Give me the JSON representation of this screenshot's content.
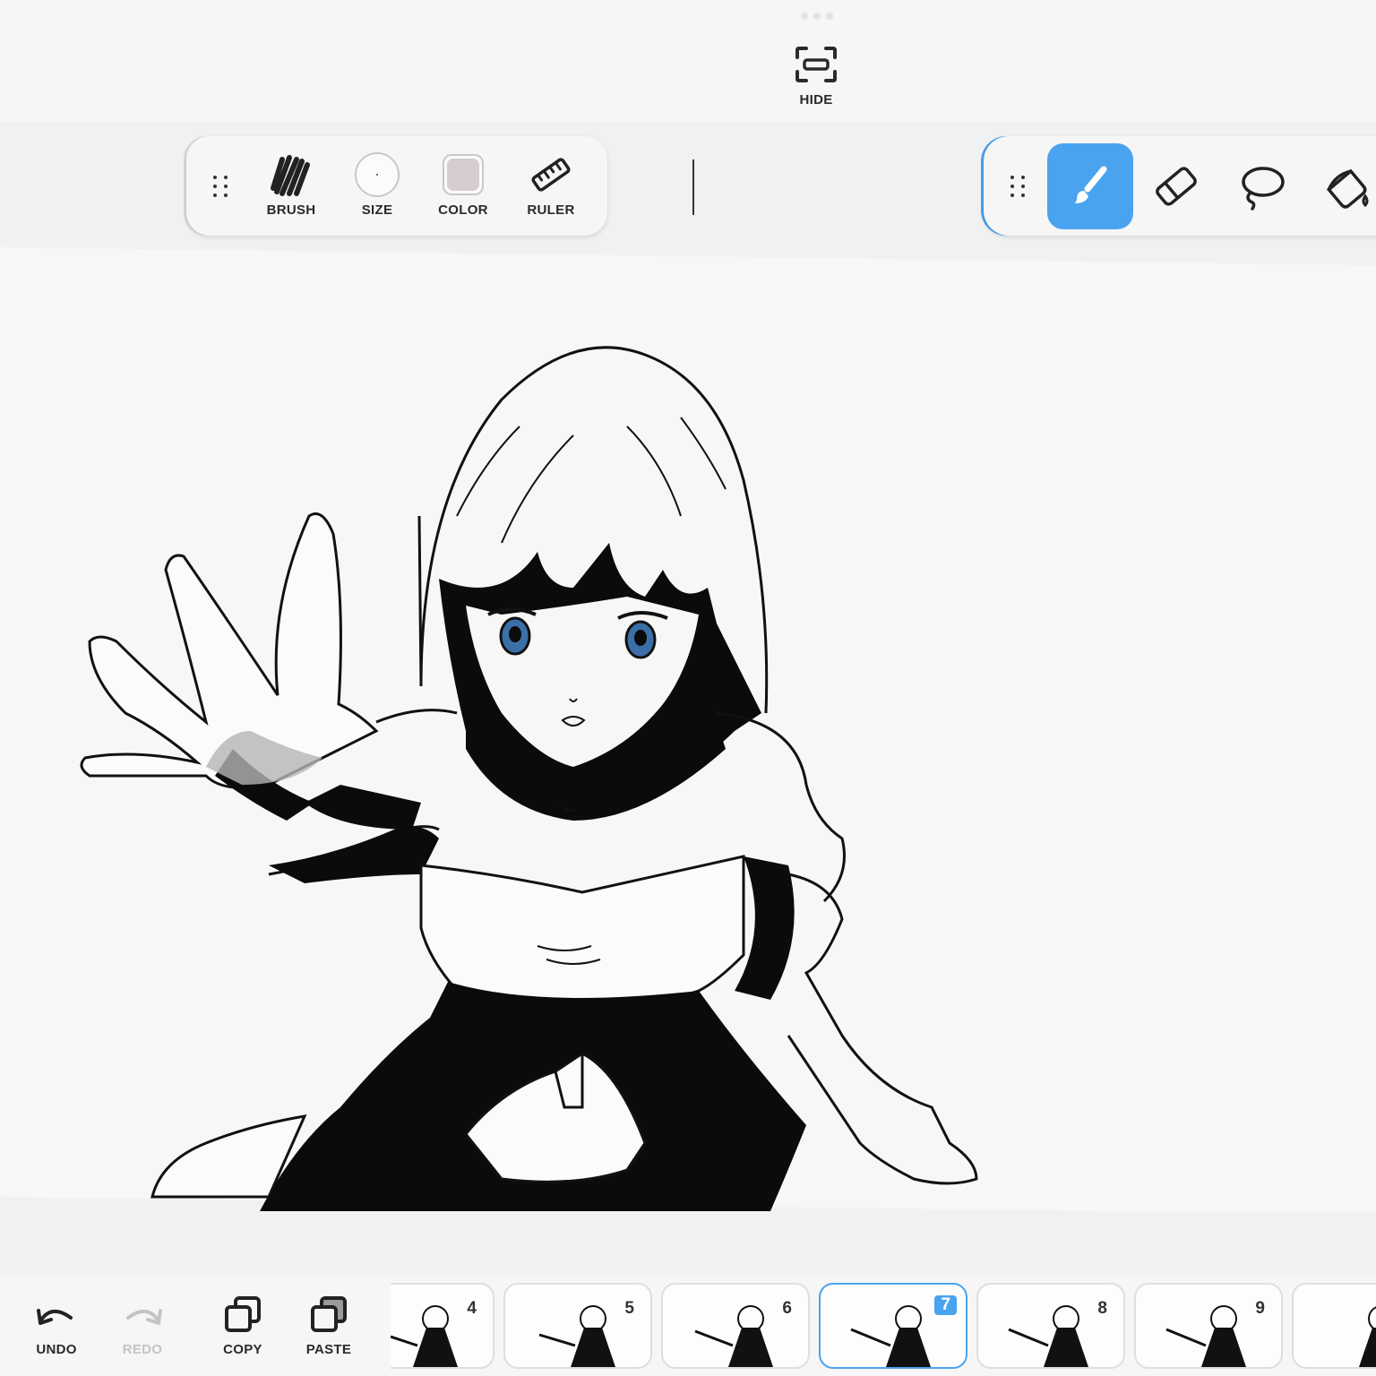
{
  "top": {
    "hide_label": "HIDE"
  },
  "left_toolbar": {
    "brush_label": "BRUSH",
    "size_label": "SIZE",
    "color_label": "COLOR",
    "ruler_label": "RULER",
    "current_color": "#d6cdce"
  },
  "right_toolbar": {
    "tools": [
      "brush-icon",
      "eraser-icon",
      "lasso-icon",
      "fill-bucket-icon"
    ],
    "active_tool": "brush",
    "accent_color": "#4aa3ef"
  },
  "bottom": {
    "undo_label": "UNDO",
    "redo_label": "REDO",
    "copy_label": "COPY",
    "paste_label": "PASTE"
  },
  "frames": [
    {
      "number": "4",
      "active": false
    },
    {
      "number": "5",
      "active": false
    },
    {
      "number": "6",
      "active": false
    },
    {
      "number": "7",
      "active": true
    },
    {
      "number": "8",
      "active": false
    },
    {
      "number": "9",
      "active": false
    }
  ]
}
